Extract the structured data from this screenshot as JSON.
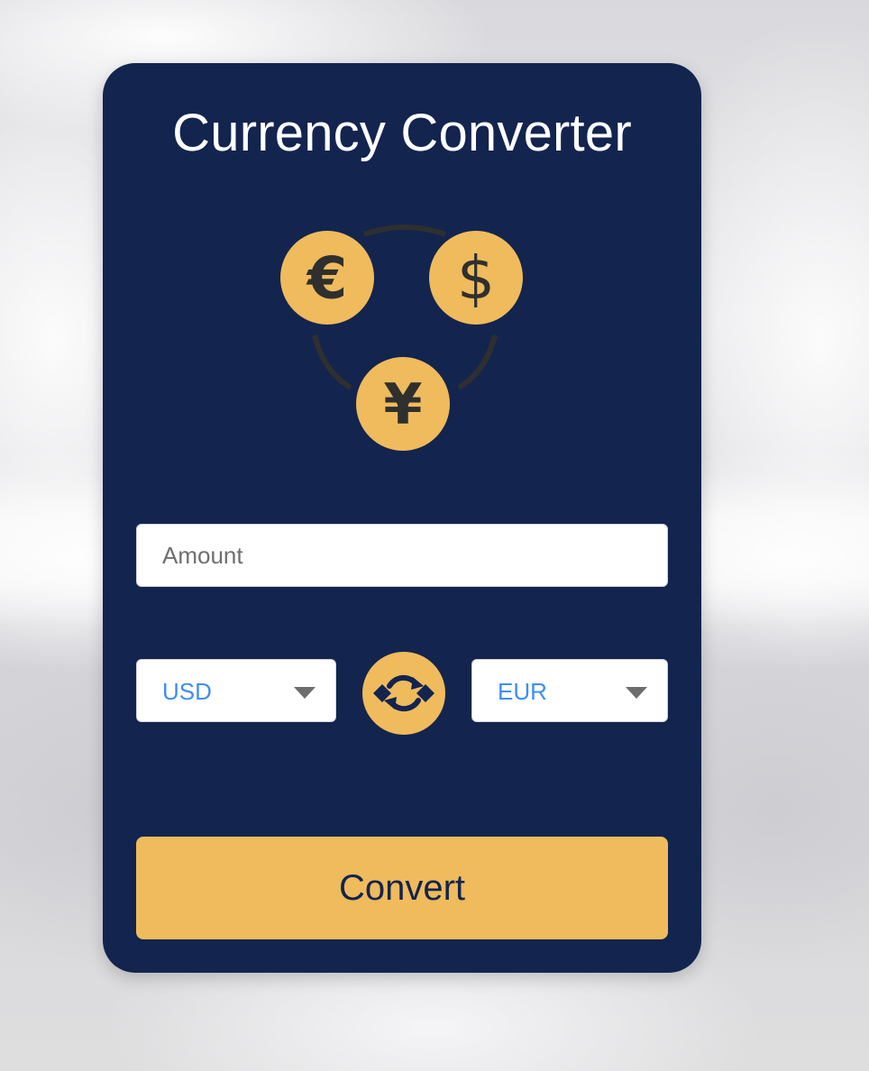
{
  "header": {
    "title": "Currency Converter"
  },
  "logo": {
    "icon": "currency-exchange-logo",
    "symbols": {
      "euro": "€",
      "dollar": "$",
      "yen": "¥"
    }
  },
  "form": {
    "amount_placeholder": "Amount",
    "amount_value": "",
    "from_currency": "USD",
    "to_currency": "EUR",
    "swap_icon": "swap-arrows-icon",
    "convert_label": "Convert"
  },
  "colors": {
    "card_background": "#13244f",
    "accent": "#efbb5c",
    "select_text": "#3f8ef0",
    "title_text": "#ffffff"
  }
}
